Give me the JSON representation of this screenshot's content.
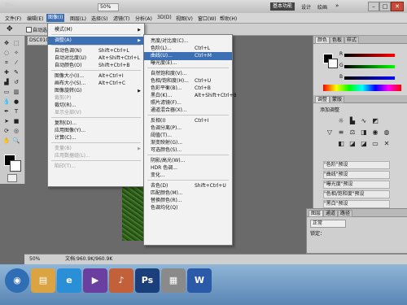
{
  "app": {
    "logo": "Ps",
    "zoom": "50%",
    "workspace_basic": "基本功能",
    "workspace_design": "设计",
    "workspace_paint": "绘画",
    "more_label": "»"
  },
  "menubar": [
    "文件(F)",
    "编辑(E)",
    "图像(I)",
    "图层(L)",
    "选择(S)",
    "滤镜(T)",
    "分析(A)",
    "3D(D)",
    "视图(V)",
    "窗口(W)",
    "帮助(H)"
  ],
  "options": {
    "auto_select": "自动选"
  },
  "document": {
    "tab": "DSC010"
  },
  "image_menu": [
    {
      "label": "模式(M)",
      "shortcut": "",
      "sub": true
    },
    {
      "sep": true
    },
    {
      "label": "调整(A)",
      "shortcut": "",
      "sub": true,
      "hl": true
    },
    {
      "sep": true
    },
    {
      "label": "自动色调(N)",
      "shortcut": "Shift+Ctrl+L"
    },
    {
      "label": "自动对比度(U)",
      "shortcut": "Alt+Shift+Ctrl+L"
    },
    {
      "label": "自动颜色(O)",
      "shortcut": "Shift+Ctrl+B"
    },
    {
      "sep": true
    },
    {
      "label": "图像大小(I)...",
      "shortcut": "Alt+Ctrl+I"
    },
    {
      "label": "画布大小(S)...",
      "shortcut": "Alt+Ctrl+C"
    },
    {
      "label": "图像旋转(G)",
      "shortcut": "",
      "sub": true
    },
    {
      "label": "裁剪(P)",
      "shortcut": "",
      "disabled": true
    },
    {
      "label": "裁切(R)...",
      "shortcut": ""
    },
    {
      "label": "显示全部(V)",
      "shortcut": "",
      "disabled": true
    },
    {
      "sep": true
    },
    {
      "label": "复制(D)...",
      "shortcut": ""
    },
    {
      "label": "应用图像(Y)...",
      "shortcut": ""
    },
    {
      "label": "计算(C)...",
      "shortcut": ""
    },
    {
      "sep": true
    },
    {
      "label": "变量(B)",
      "shortcut": "",
      "sub": true,
      "disabled": true
    },
    {
      "label": "应用数据组(L)...",
      "shortcut": "",
      "disabled": true
    },
    {
      "sep": true
    },
    {
      "label": "陷印(T)...",
      "shortcut": "",
      "disabled": true
    }
  ],
  "adjust_menu": [
    {
      "label": "亮度/对比度(C)...",
      "shortcut": ""
    },
    {
      "label": "色阶(L)...",
      "shortcut": "Ctrl+L"
    },
    {
      "label": "曲线(U)...",
      "shortcut": "Ctrl+M",
      "hl": true
    },
    {
      "label": "曝光度(E)...",
      "shortcut": ""
    },
    {
      "sep": true
    },
    {
      "label": "自然饱和度(V)...",
      "shortcut": ""
    },
    {
      "label": "色相/饱和度(H)...",
      "shortcut": "Ctrl+U"
    },
    {
      "label": "色彩平衡(B)...",
      "shortcut": "Ctrl+B"
    },
    {
      "label": "黑白(K)...",
      "shortcut": "Alt+Shift+Ctrl+B"
    },
    {
      "label": "照片滤镜(F)...",
      "shortcut": ""
    },
    {
      "label": "通道混合器(X)...",
      "shortcut": ""
    },
    {
      "sep": true
    },
    {
      "label": "反相(I)",
      "shortcut": "Ctrl+I"
    },
    {
      "label": "色调分离(P)...",
      "shortcut": ""
    },
    {
      "label": "阈值(T)...",
      "shortcut": ""
    },
    {
      "label": "渐变映射(G)...",
      "shortcut": ""
    },
    {
      "label": "可选颜色(S)...",
      "shortcut": ""
    },
    {
      "sep": true
    },
    {
      "label": "阴影/高光(W)...",
      "shortcut": ""
    },
    {
      "label": "HDR 色调...",
      "shortcut": ""
    },
    {
      "label": "变化...",
      "shortcut": ""
    },
    {
      "sep": true
    },
    {
      "label": "去色(D)",
      "shortcut": "Shift+Ctrl+U"
    },
    {
      "label": "匹配颜色(M)...",
      "shortcut": ""
    },
    {
      "label": "替换颜色(R)...",
      "shortcut": ""
    },
    {
      "label": "色调均化(Q)",
      "shortcut": ""
    }
  ],
  "panels": {
    "color_tabs": [
      "颜色",
      "色板",
      "样式"
    ],
    "color_letters": [
      "R",
      "G",
      "B"
    ],
    "adjust_tabs": [
      "调整",
      "蒙版"
    ],
    "add_adjust": "添加调整",
    "presets": [
      "\"色阶\"预设",
      "\"曲线\"预设",
      "\"曝光度\"预设",
      "\"色相/饱和度\"预设",
      "\"黑白\"预设"
    ],
    "layers_tabs": [
      "图层",
      "通道",
      "路径"
    ],
    "blend_mode": "正常",
    "lock_label": "锁定："
  },
  "status": {
    "zoom": "50%",
    "doc_info": "文档:960.9K/960.9K"
  },
  "taskbar": {
    "apps": [
      {
        "name": "start-orb",
        "glyph": "◉",
        "color": "#2f6db5"
      },
      {
        "name": "explorer",
        "glyph": "▤",
        "color": "#d9a441"
      },
      {
        "name": "ie",
        "glyph": "e",
        "color": "#2a8fd6"
      },
      {
        "name": "media",
        "glyph": "▶",
        "color": "#6b3fa0"
      },
      {
        "name": "music",
        "glyph": "♪",
        "color": "#c2603a"
      },
      {
        "name": "photoshop",
        "glyph": "Ps",
        "color": "#1b3f7a"
      },
      {
        "name": "docs",
        "glyph": "▦",
        "color": "#8a8a8a"
      },
      {
        "name": "word",
        "glyph": "W",
        "color": "#2b5aa8"
      }
    ]
  }
}
